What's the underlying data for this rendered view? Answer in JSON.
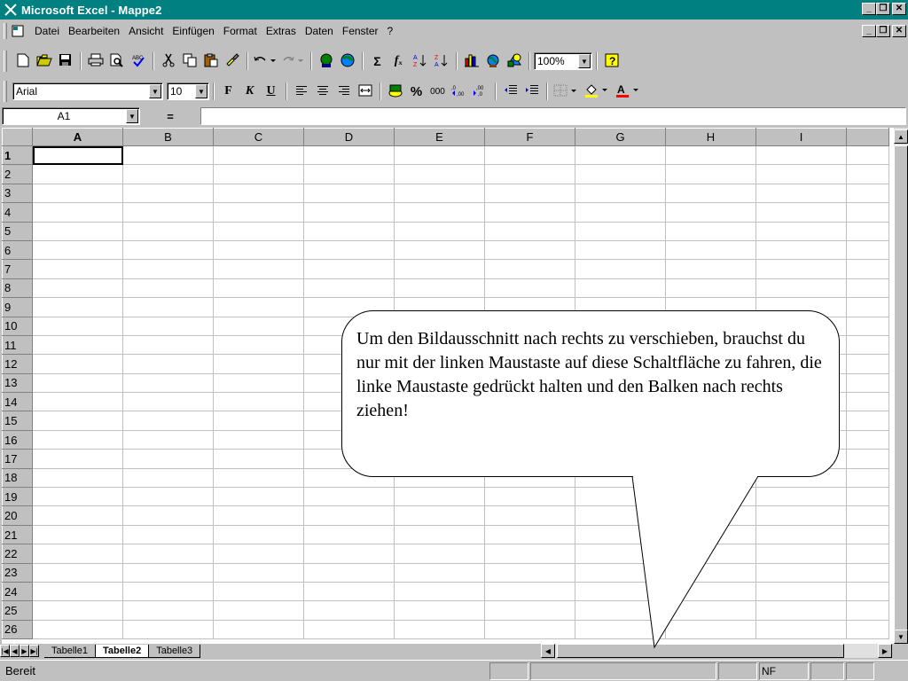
{
  "window": {
    "title": "Microsoft Excel - Mappe2",
    "minimize": "_",
    "restore": "❐",
    "close": "✕"
  },
  "menubar": {
    "items": [
      "Datei",
      "Bearbeiten",
      "Ansicht",
      "Einfügen",
      "Format",
      "Extras",
      "Daten",
      "Fenster",
      "?"
    ]
  },
  "toolbar_standard": {
    "zoom_value": "100%"
  },
  "toolbar_format": {
    "font_value": "Arial",
    "size_value": "10",
    "bold_label": "F",
    "italic_label": "K",
    "underline_label": "U",
    "percent_label": "%",
    "thousands_label": "000",
    "sum_label": "Σ",
    "fx_label": "fₓ"
  },
  "formulabar": {
    "namebox_value": "A1",
    "equals_label": "="
  },
  "sheet": {
    "columns": [
      "A",
      "B",
      "C",
      "D",
      "E",
      "F",
      "G",
      "H",
      "I"
    ],
    "rows": [
      "1",
      "2",
      "3",
      "4",
      "5",
      "6",
      "7",
      "8",
      "9",
      "10",
      "11",
      "12",
      "13",
      "14",
      "15",
      "16",
      "17",
      "18",
      "19",
      "20",
      "21",
      "22",
      "23",
      "24",
      "25",
      "26"
    ],
    "active_cell": "A1"
  },
  "tabs": {
    "items": [
      "Tabelle1",
      "Tabelle2",
      "Tabelle3"
    ],
    "active": "Tabelle2"
  },
  "statusbar": {
    "status": "Bereit",
    "nf": "NF"
  },
  "callout": {
    "text": "Um den Bildausschnitt nach rechts zu verschieben, brauchst du nur mit der linken Maustaste auf diese Schaltfläche zu fahren, die linke Maustaste gedrückt halten und den Balken nach rechts ziehen!"
  },
  "colors": {
    "title_bg": "#008080",
    "face": "#c0c0c0",
    "window": "#ffffff"
  },
  "icons": [
    "new-icon",
    "open-icon",
    "save-icon",
    "print-icon",
    "print-preview-icon",
    "spellcheck-icon",
    "cut-icon",
    "copy-icon",
    "paste-icon",
    "format-painter-icon",
    "undo-icon",
    "redo-icon",
    "web-icon",
    "hyperlink-icon",
    "autosum-icon",
    "function-icon",
    "sort-asc-icon",
    "sort-desc-icon",
    "chart-wizard-icon",
    "map-icon",
    "drawing-icon",
    "help-icon"
  ]
}
